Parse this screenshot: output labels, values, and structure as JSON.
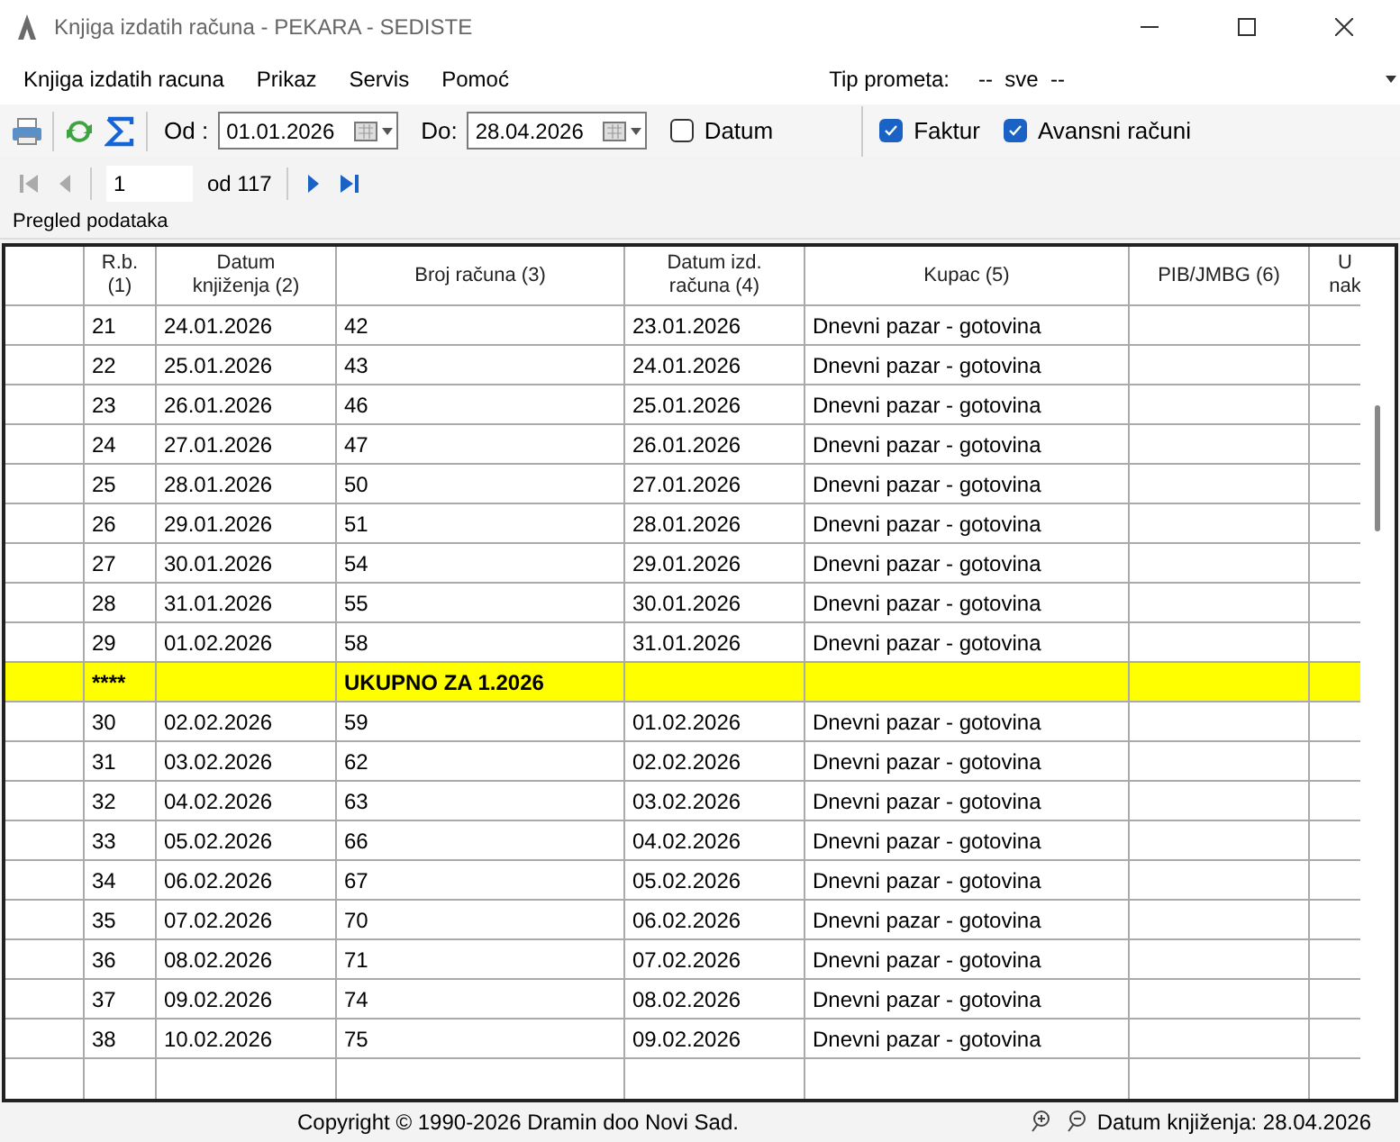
{
  "window": {
    "title": "Knjiga izdatih računa - PEKARA - SEDISTE"
  },
  "menu": [
    "Knjiga izdatih racuna",
    "Prikaz",
    "Servis",
    "Pomoć"
  ],
  "tip_prometa": {
    "label": "Tip prometa:",
    "value": "--  sve  --"
  },
  "filter": {
    "from_label": "Od :",
    "from": "01.01.2026",
    "to_label": "Do:",
    "to": "28.04.2026",
    "datum": {
      "label": "Datum",
      "checked": false
    },
    "faktur": {
      "label": "Faktur",
      "checked": true
    },
    "avansni": {
      "label": "Avansni računi",
      "checked": true
    }
  },
  "pager": {
    "page": "1",
    "of": "od 117"
  },
  "section_label": "Pregled podataka",
  "table": {
    "columns": [
      "R.b.\n(1)",
      "Datum\nknjiženja (2)",
      "Broj računa (3)",
      "Datum izd.\nračuna (4)",
      "Kupac (5)",
      "PIB/JMBG (6)",
      "U\nnak"
    ],
    "rows": [
      {
        "kind": "data",
        "cells": [
          "21",
          "24.01.2026",
          "42",
          "23.01.2026",
          "Dnevni pazar - gotovina"
        ]
      },
      {
        "kind": "data",
        "cells": [
          "22",
          "25.01.2026",
          "43",
          "24.01.2026",
          "Dnevni pazar - gotovina"
        ]
      },
      {
        "kind": "data",
        "cells": [
          "23",
          "26.01.2026",
          "46",
          "25.01.2026",
          "Dnevni pazar - gotovina"
        ]
      },
      {
        "kind": "data",
        "cells": [
          "24",
          "27.01.2026",
          "47",
          "26.01.2026",
          "Dnevni pazar - gotovina"
        ]
      },
      {
        "kind": "data",
        "cells": [
          "25",
          "28.01.2026",
          "50",
          "27.01.2026",
          "Dnevni pazar - gotovina"
        ]
      },
      {
        "kind": "data",
        "cells": [
          "26",
          "29.01.2026",
          "51",
          "28.01.2026",
          "Dnevni pazar - gotovina"
        ]
      },
      {
        "kind": "data",
        "cells": [
          "27",
          "30.01.2026",
          "54",
          "29.01.2026",
          "Dnevni pazar - gotovina"
        ]
      },
      {
        "kind": "data",
        "cells": [
          "28",
          "31.01.2026",
          "55",
          "30.01.2026",
          "Dnevni pazar - gotovina"
        ]
      },
      {
        "kind": "data",
        "cells": [
          "29",
          "01.02.2026",
          "58",
          "31.01.2026",
          "Dnevni pazar - gotovina"
        ]
      },
      {
        "kind": "total",
        "cells": [
          "****",
          "",
          "UKUPNO ZA 1.2026",
          "",
          ""
        ]
      },
      {
        "kind": "data",
        "cells": [
          "30",
          "02.02.2026",
          "59",
          "01.02.2026",
          "Dnevni pazar - gotovina"
        ]
      },
      {
        "kind": "data",
        "cells": [
          "31",
          "03.02.2026",
          "62",
          "02.02.2026",
          "Dnevni pazar - gotovina"
        ]
      },
      {
        "kind": "data",
        "cells": [
          "32",
          "04.02.2026",
          "63",
          "03.02.2026",
          "Dnevni pazar - gotovina"
        ]
      },
      {
        "kind": "data",
        "cells": [
          "33",
          "05.02.2026",
          "66",
          "04.02.2026",
          "Dnevni pazar - gotovina"
        ]
      },
      {
        "kind": "data",
        "cells": [
          "34",
          "06.02.2026",
          "67",
          "05.02.2026",
          "Dnevni pazar - gotovina"
        ]
      },
      {
        "kind": "data",
        "cells": [
          "35",
          "07.02.2026",
          "70",
          "06.02.2026",
          "Dnevni pazar - gotovina"
        ]
      },
      {
        "kind": "data",
        "cells": [
          "36",
          "08.02.2026",
          "71",
          "07.02.2026",
          "Dnevni pazar - gotovina"
        ]
      },
      {
        "kind": "data",
        "cells": [
          "37",
          "09.02.2026",
          "74",
          "08.02.2026",
          "Dnevni pazar - gotovina"
        ]
      },
      {
        "kind": "data",
        "cells": [
          "38",
          "10.02.2026",
          "75",
          "09.02.2026",
          "Dnevni pazar - gotovina"
        ]
      }
    ]
  },
  "status": {
    "copyright": "Copyright © 1990-2026 Dramin doo Novi Sad.",
    "date": "Datum knjiženja: 28.04.2026"
  }
}
